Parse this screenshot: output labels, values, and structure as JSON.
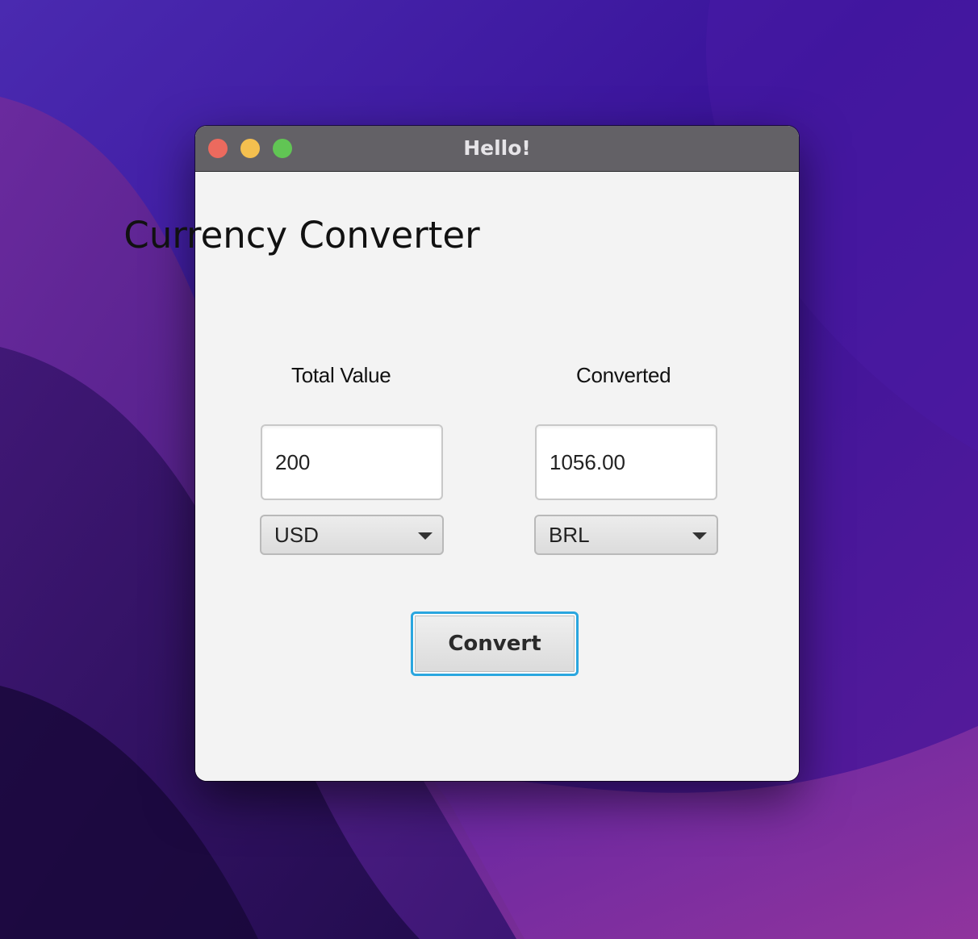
{
  "window": {
    "title": "Hello!"
  },
  "app": {
    "title": "Currency Converter"
  },
  "left": {
    "label": "Total Value",
    "value": "200",
    "currency": "USD"
  },
  "right": {
    "label": "Converted",
    "value": "1056.00",
    "currency": "BRL"
  },
  "actions": {
    "convert_label": "Convert"
  },
  "colors": {
    "close": "#ec6a5e",
    "minimize": "#f4bf4f",
    "zoom": "#61c554",
    "focus_ring": "#2aa6df"
  }
}
